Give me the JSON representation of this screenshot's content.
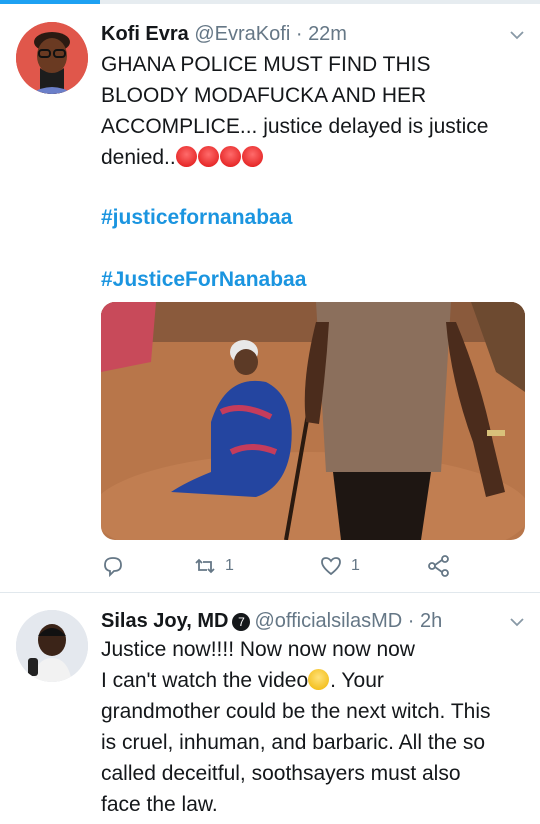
{
  "tweets": [
    {
      "author_name": "Kofi Evra",
      "handle": "@EvraKofi",
      "separator": "·",
      "time": "22m",
      "text_line1": "GHANA POLICE MUST  FIND THIS",
      "text_line2": "BLOODY MODAFUCKA AND HER",
      "text_line3": "ACCOMPLICE... justice delayed is justice",
      "text_line4": "denied..",
      "emoji": [
        "angry-face",
        "angry-face",
        "angry-face",
        "angry-face"
      ],
      "hashtag1": "#justicefornanabaa",
      "hashtag2": "#JusticeForNanabaa",
      "media": "video-thumbnail",
      "actions": {
        "reply_icon": "reply-icon",
        "retweet_count": "1",
        "like_count": "1",
        "share_icon": "share-icon"
      }
    },
    {
      "author_name": "Silas Joy, MD",
      "verified_icon": "verified-badge",
      "verified_glyph": "7",
      "handle": "@officialsilasMD",
      "separator": "·",
      "time": "2h",
      "line1": "Justice now!!!! Now now now now",
      "line2a": "I can't watch the video",
      "line2b": ". Your",
      "line3": "grandmother could be the next witch. This",
      "line4": "is cruel, inhuman, and barbaric. All the so",
      "line5": "called deceitful, soothsayers must also",
      "line6": "face the law."
    }
  ],
  "colors": {
    "link": "#1b95e0",
    "secondary": "#657786",
    "text": "#14171a"
  }
}
